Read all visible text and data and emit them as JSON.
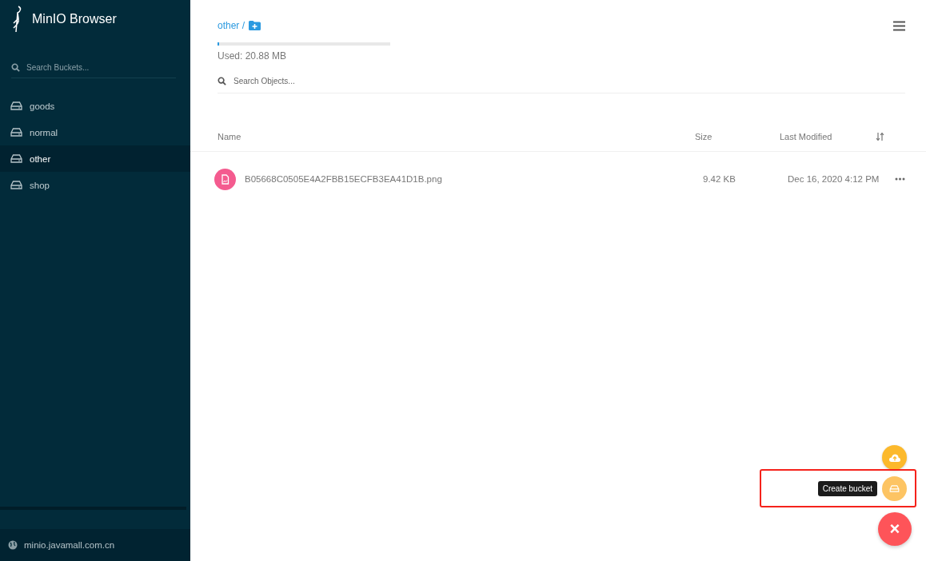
{
  "sidebar": {
    "title": "MinIO Browser",
    "search": {
      "placeholder": "Search Buckets..."
    },
    "buckets": [
      {
        "name": "goods",
        "selected": false
      },
      {
        "name": "normal",
        "selected": false
      },
      {
        "name": "other",
        "selected": true
      },
      {
        "name": "shop",
        "selected": false
      }
    ],
    "host": "minio.javamall.com.cn"
  },
  "header": {
    "breadcrumb": "other /",
    "usage": {
      "level": 0.01,
      "label": "Used: 20.88 MB"
    },
    "search": {
      "placeholder": "Search Objects..."
    }
  },
  "table": {
    "columns": [
      "Name",
      "Size",
      "Last Modified"
    ],
    "rows": [
      {
        "name": "B05668C0505E4A2FBB15ECFB3EA41D1B.png",
        "size": "9.42 KB",
        "modified": "Dec 16, 2020 4:12 PM"
      }
    ]
  },
  "fab": {
    "tooltip": "Create bucket",
    "close": "×",
    "highlighted": true
  }
}
